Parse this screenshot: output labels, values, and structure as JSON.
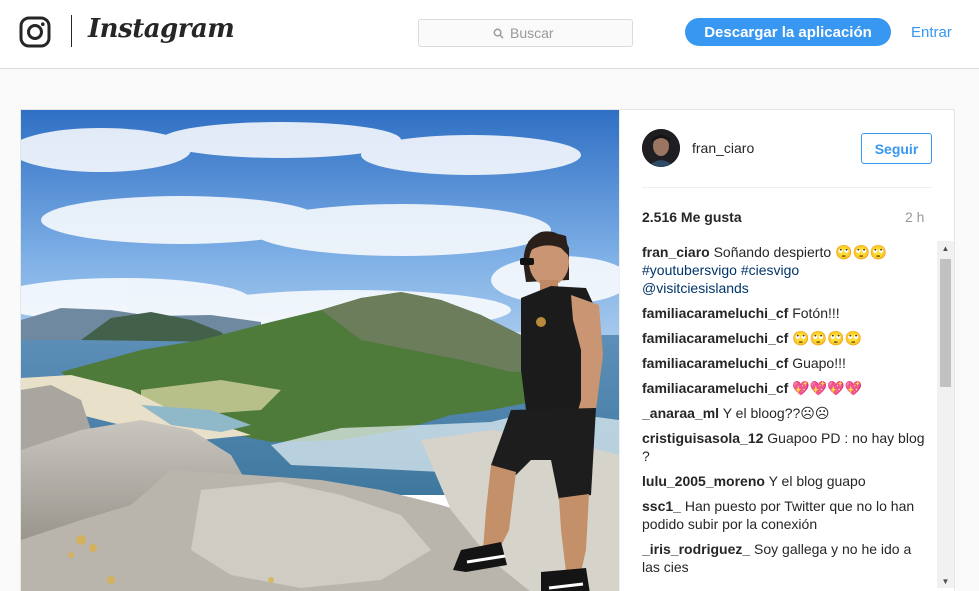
{
  "header": {
    "wordmark": "Instagram",
    "search_placeholder": "Buscar",
    "download_label": "Descargar la aplicación",
    "login_label": "Entrar"
  },
  "post": {
    "author": "fran_ciaro",
    "follow_label": "Seguir",
    "likes": "2.516 Me gusta",
    "age": "2 h",
    "caption": {
      "user": "fran_ciaro",
      "text": "Soñando despierto 🙄🙄🙄",
      "hashtags": "#youtubersvigo #ciesvigo",
      "mention": "@visitciesislands"
    },
    "comments": [
      {
        "user": "familiacarameluchi_cf",
        "text": "Fotón!!!"
      },
      {
        "user": "familiacarameluchi_cf",
        "text": "🙄🙄🙄🙄"
      },
      {
        "user": "familiacarameluchi_cf",
        "text": "Guapo!!!"
      },
      {
        "user": "familiacarameluchi_cf",
        "text": "💖💖💖💖"
      },
      {
        "user": "_anaraa_ml",
        "text": "Y el bloog??☹☹"
      },
      {
        "user": "cristiguisasola_12",
        "text": "Guapoo PD : no hay blog ?"
      },
      {
        "user": "lulu_2005_moreno",
        "text": "Y el blog guapo"
      },
      {
        "user": "ssc1_",
        "text": "Han puesto por Twitter que no lo han podido subir por la conexión"
      },
      {
        "user": "_iris_rodriguez_",
        "text": "Soy gallega y no he ido a las cies"
      }
    ]
  },
  "icons": {
    "logo": "instagram-camera-icon",
    "search": "search-icon",
    "scroll_up": "scroll-up-arrow-icon",
    "scroll_down": "scroll-down-arrow-icon"
  },
  "colors": {
    "accent": "#3897f0",
    "link": "#003569",
    "border": "#dbdbdb",
    "text": "#262626",
    "muted": "#999999"
  }
}
